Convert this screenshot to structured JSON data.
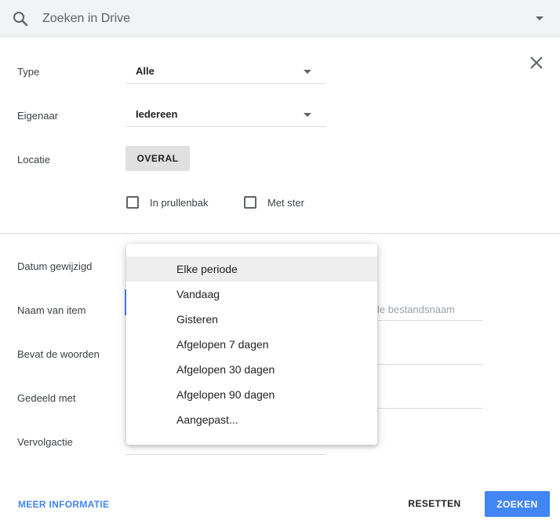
{
  "search": {
    "placeholder": "Zoeken in Drive",
    "icon": "search-icon",
    "options_icon": "caret-down-icon"
  },
  "dialog": {
    "close_icon": "close-icon",
    "type": {
      "label": "Type",
      "value": "Alle"
    },
    "owner": {
      "label": "Eigenaar",
      "value": "Iedereen"
    },
    "location": {
      "label": "Locatie",
      "button": "OVERAL"
    },
    "checkboxes": [
      {
        "label": "In prullenbak",
        "checked": false
      },
      {
        "label": "Met ster",
        "checked": false
      }
    ],
    "date_modified": {
      "label": "Datum gewijzigd"
    },
    "item_name": {
      "label": "Naam van item",
      "placeholder_partial": "le bestandsnaam"
    },
    "contains_words": {
      "label": "Bevat de woorden"
    },
    "shared_with": {
      "label": "Gedeeld met"
    },
    "follow_up": {
      "label": "Vervolgactie"
    }
  },
  "date_menu": {
    "selected": "Elke periode",
    "options": [
      "Elke periode",
      "Vandaag",
      "Gisteren",
      "Afgelopen 7 dagen",
      "Afgelopen 30 dagen",
      "Afgelopen 90 dagen",
      "Aangepast..."
    ]
  },
  "footer": {
    "more_info": "MEER INFORMATIE",
    "reset": "RESETTEN",
    "search": "ZOEKEN"
  },
  "colors": {
    "accent": "#4285f4",
    "search_bg": "#f1f3f4",
    "button_bg": "#e0e0e0"
  }
}
